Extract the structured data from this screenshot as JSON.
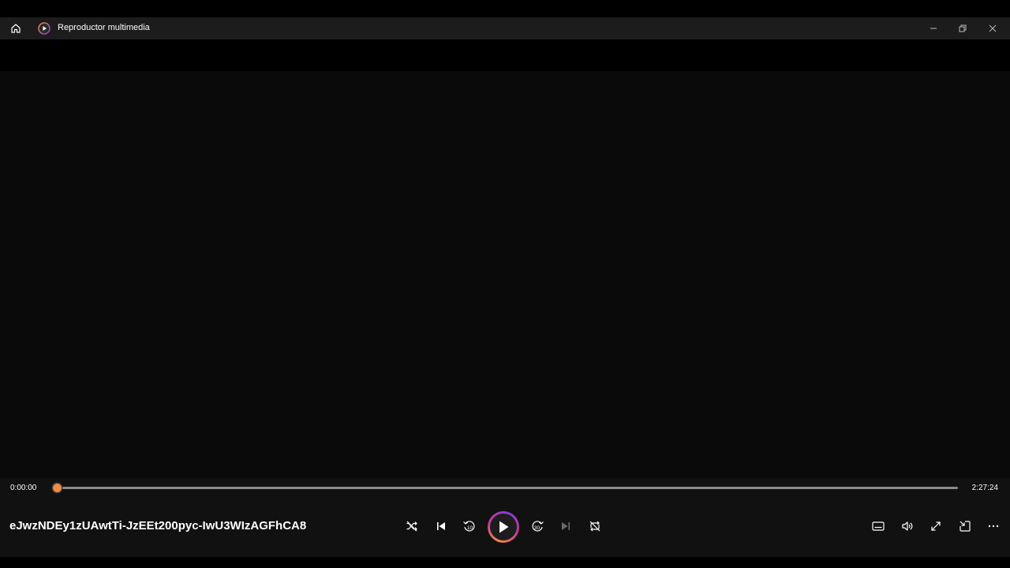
{
  "window": {
    "title": "Reproductor multimedia"
  },
  "playback": {
    "current_time": "0:00:00",
    "total_time": "2:27:24",
    "progress": 0
  },
  "now_playing": {
    "title": "eJwzNDEy1zUAwtTi-JzEEt200pyc-IwU3WIzAGFhCA8"
  },
  "colors": {
    "accent": "#f28b44",
    "background": "#000000",
    "titlebar": "#1c1c1c",
    "control_panel": "#111111"
  },
  "icons": {
    "home": "home-icon",
    "app": "media-player-icon",
    "minimize": "minimize-icon",
    "restore": "restore-icon",
    "close": "close-icon",
    "shuffle": "shuffle-icon",
    "previous": "previous-icon",
    "rewind": "rewind-10-icon",
    "play": "play-icon",
    "forward": "forward-30-icon",
    "next": "next-icon",
    "repeat": "repeat-off-icon",
    "captions": "captions-icon",
    "volume": "volume-icon",
    "fullscreen": "fullscreen-icon",
    "miniplayer": "miniplayer-icon",
    "more": "more-options-icon"
  }
}
